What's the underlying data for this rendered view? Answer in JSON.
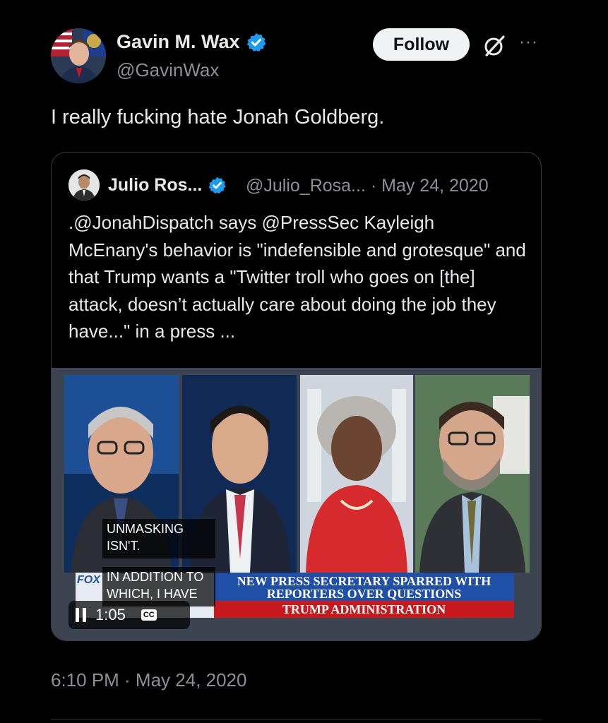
{
  "author": {
    "name": "Gavin M. Wax",
    "handle": "@GavinWax",
    "verified": true,
    "avatar_icon": "avatar-photo"
  },
  "actions": {
    "follow_label": "Follow",
    "grok_icon": "grok-icon",
    "more_icon": "more-icon",
    "more_glyph": "···"
  },
  "tweet": {
    "text": "I really fucking hate Jonah Goldberg.",
    "timestamp": "6:10 PM · May 24, 2020"
  },
  "quote": {
    "name": "Julio Ros...",
    "handle_meta": "@Julio_Rosa... · May 24, 2020",
    "verified": true,
    "text": ".@JonahDispatch says @PressSec Kayleigh McEnany's behavior is \"indefensible and grotesque\" and that Trump wants a \"Twitter troll who goes on [the] attack, doesn’t actually care about doing the job they have...\" in a press ...",
    "video": {
      "chyron_line1": "NEW PRESS SECRETARY SPARRED WITH",
      "chyron_line2": "REPORTERS OVER QUESTIONS",
      "chyron_bottom": "TRUMP ADMINISTRATION",
      "caption_1_line1": "UNMASKING",
      "caption_1_line2": "ISN'T.",
      "caption_2_line1": "IN ADDITION TO",
      "caption_2_line2": "WHICH, I HAVE",
      "time": "1:05",
      "cc_label": "CC",
      "logo_text": "FOX",
      "progress": 0.0
    }
  },
  "colors": {
    "background": "#000000",
    "text_primary": "#e7e9ea",
    "text_secondary": "#8b9096",
    "verified_blue": "#1d9bf0",
    "follow_bg": "#eff3f4"
  }
}
